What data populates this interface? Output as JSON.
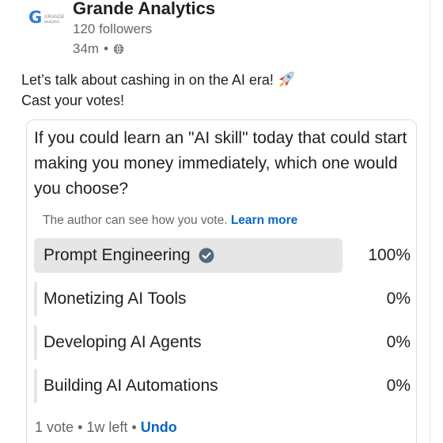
{
  "post": {
    "company_name": "Grande Analytics",
    "logo_letter": "G",
    "logo_line1": "GRANDE",
    "logo_line2": "analytics",
    "followers": "120 followers",
    "time": "34m",
    "visibility_icon": "globe-icon",
    "text_line1": "Let’s talk about cashing in on the AI era!",
    "text_emoji_icon": "rocket-icon",
    "text_line2": "Cast your votes!"
  },
  "poll": {
    "question": "If you could learn an \"AI skill\" today that could start making you money immediately, which one would you choose?",
    "notice": "The author can see how you vote.",
    "learn_more": "Learn more",
    "options": [
      {
        "label": "Prompt Engineering",
        "percent": "100%",
        "fill_fraction": 1.0,
        "selected": true
      },
      {
        "label": "Monetizing AI Tools",
        "percent": "0%",
        "fill_fraction": 0.0,
        "selected": false
      },
      {
        "label": "Developing AI Agents",
        "percent": "0%",
        "fill_fraction": 0.0,
        "selected": false
      },
      {
        "label": "Building AI Automations",
        "percent": "0%",
        "fill_fraction": 0.0,
        "selected": false
      }
    ],
    "votes": "1 vote",
    "time_left": "1w left",
    "undo": "Undo"
  },
  "colors": {
    "link": "#0a66c2",
    "bar": "#e6e6e6",
    "check": "#56687a",
    "logo": "#2f7dd3"
  }
}
